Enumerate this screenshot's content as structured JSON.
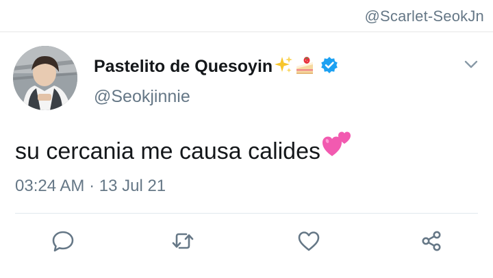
{
  "watermark": "@Scarlet-SeokJn",
  "tweet": {
    "display_name": "Pastelito de Quesoyin",
    "handle": "@Seokjinnie",
    "text": "su cercania me causa calides",
    "timestamp": "03:24 AM · 13 Jul 21",
    "name_emojis": [
      "sparkles-icon",
      "strawberry-shortcake-icon"
    ],
    "text_emoji": "two-hearts-icon",
    "verified": true
  },
  "actions": [
    {
      "name": "reply",
      "icon": "speech-bubble-icon"
    },
    {
      "name": "retweet",
      "icon": "retweet-icon"
    },
    {
      "name": "like",
      "icon": "heart-outline-icon"
    },
    {
      "name": "share",
      "icon": "share-nodes-icon"
    }
  ],
  "colors": {
    "primary_text": "#14171a",
    "secondary_text": "#657786",
    "verified_blue": "#1da1f2",
    "divider": "#e1e8ed",
    "icon_gray": "#657786"
  }
}
